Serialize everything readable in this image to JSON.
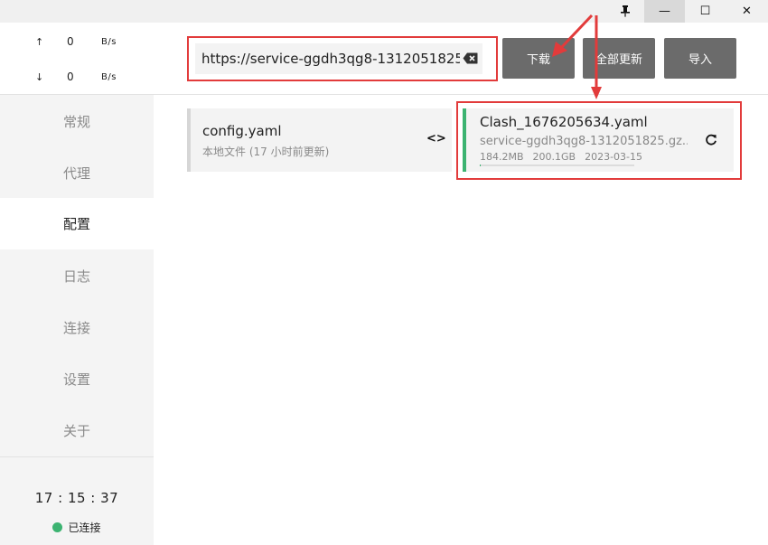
{
  "window": {
    "pin_icon": "pin-icon",
    "min_glyph": "—",
    "max_glyph": "☐",
    "close_glyph": "✕"
  },
  "speed": {
    "up_arrow": "↑",
    "up_value": "0",
    "up_unit": "B/s",
    "down_arrow": "↓",
    "down_value": "0",
    "down_unit": "B/s"
  },
  "nav": {
    "items": [
      {
        "label": "常规"
      },
      {
        "label": "代理"
      },
      {
        "label": "配置"
      },
      {
        "label": "日志"
      },
      {
        "label": "连接"
      },
      {
        "label": "设置"
      },
      {
        "label": "关于"
      }
    ],
    "active_index": 2
  },
  "footer": {
    "clock": "17 : 15 : 37",
    "status": "已连接",
    "status_color": "#3cb371"
  },
  "toolbar": {
    "url_value": "https://service-ggdh3qg8-1312051825",
    "download_label": "下载",
    "update_all_label": "全部更新",
    "import_label": "导入"
  },
  "profiles": [
    {
      "title": "config.yaml",
      "subtitle": "本地文件 (17 小时前更新)",
      "action_icon": "<>"
    },
    {
      "title": "Clash_1676205634.yaml",
      "url": "service-ggdh3qg8-1312051825.gz....",
      "used": "184.2MB",
      "total": "200.1GB",
      "expire": "2023-03-15",
      "usage_fraction": 0.0009,
      "accent": "#3cb371"
    }
  ],
  "colors": {
    "annotation_red": "#e23b3b",
    "button_gray": "#6b6b6b"
  }
}
